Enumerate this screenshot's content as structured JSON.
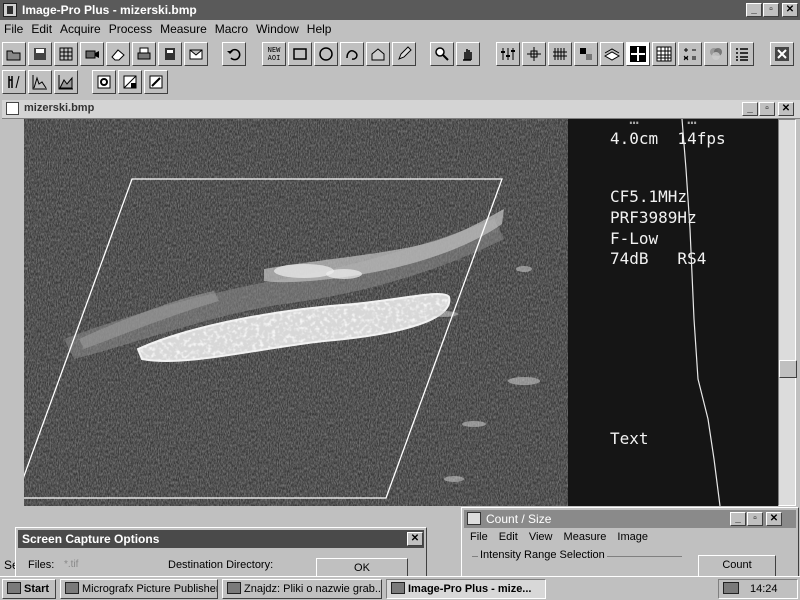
{
  "app": {
    "title": "Image-Pro Plus - mizerski.bmp"
  },
  "window_controls": {
    "minimize": "_",
    "restore": "▫",
    "close": "✕"
  },
  "menu": [
    {
      "label": "File"
    },
    {
      "label": "Edit"
    },
    {
      "label": "Acquire"
    },
    {
      "label": "Process"
    },
    {
      "label": "Measure"
    },
    {
      "label": "Macro"
    },
    {
      "label": "Window"
    },
    {
      "label": "Help"
    }
  ],
  "toolbar": {
    "new_aoi_label_top": "NEW",
    "new_aoi_label_bottom": "AOI"
  },
  "document": {
    "title": "mizerski.bmp",
    "overlay": {
      "depth_line": "4.0cm  14fps",
      "freq_line": "CF5.1MHz",
      "prf_line": "PRF3989Hz",
      "filter_line": "F-Low",
      "gain_line": "74dB   RS4",
      "label_text": "Text",
      "top_partial": "  …     …"
    }
  },
  "status_bar": {
    "partial_left": "Se"
  },
  "capture_dialog": {
    "title": "Screen Capture Options",
    "files_label": "Files:",
    "files_value": "*.tif",
    "dest_label": "Destination Directory:",
    "ok_label": "OK"
  },
  "count_dialog": {
    "title": "Count / Size",
    "menu": [
      {
        "label": "File"
      },
      {
        "label": "Edit"
      },
      {
        "label": "View"
      },
      {
        "label": "Measure"
      },
      {
        "label": "Image"
      }
    ],
    "group_label": "Intensity Range Selection",
    "count_button": "Count"
  },
  "taskbar": {
    "start": "Start",
    "items": [
      {
        "label": "Micrografx Picture Publisher"
      },
      {
        "label": "Znajdz: Pliki o nazwie grab..."
      },
      {
        "label": "Image-Pro Plus - mize..."
      }
    ],
    "clock": "14:24"
  }
}
